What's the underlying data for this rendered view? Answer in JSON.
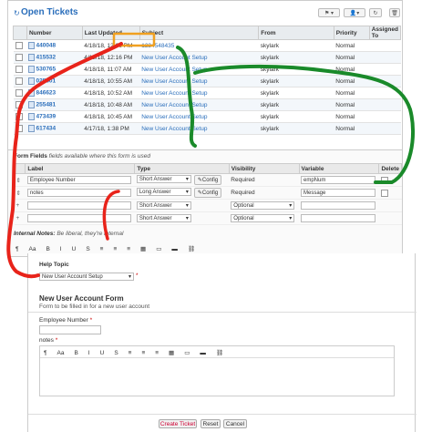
{
  "tickets": {
    "title": "Open Tickets",
    "columns": [
      "Number",
      "Last Updated",
      "Subject",
      "From",
      "Priority",
      "Assigned To"
    ],
    "rows": [
      {
        "number": "440048",
        "updated": "4/18/18, 12:26 PM",
        "subject": "1234548435",
        "from": "skylark",
        "priority": "Normal"
      },
      {
        "number": "415532",
        "updated": "4/18/18, 12:16 PM",
        "subject": "New User Account Setup",
        "from": "skylark",
        "priority": "Normal"
      },
      {
        "number": "530765",
        "updated": "4/18/18, 11:07 AM",
        "subject": "New User Account Setup",
        "from": "skylark",
        "priority": "Normal"
      },
      {
        "number": "025601",
        "updated": "4/18/18, 10:55 AM",
        "subject": "New User Account Setup",
        "from": "skylark",
        "priority": "Normal"
      },
      {
        "number": "846623",
        "updated": "4/18/18, 10:52 AM",
        "subject": "New User Account Setup",
        "from": "skylark",
        "priority": "Normal"
      },
      {
        "number": "255481",
        "updated": "4/18/18, 10:48 AM",
        "subject": "New User Account Setup",
        "from": "skylark",
        "priority": "Normal"
      },
      {
        "number": "473439",
        "updated": "4/18/18, 10:45 AM",
        "subject": "New User Account Setup",
        "from": "skylark",
        "priority": "Normal"
      },
      {
        "number": "617434",
        "updated": "4/17/18, 1:38 PM",
        "subject": "New User Account Setup",
        "from": "skylark",
        "priority": "Normal"
      }
    ]
  },
  "form_fields": {
    "heading": "Form Fields",
    "subheading": "fields available where this form is used",
    "columns": [
      "Label",
      "Type",
      "Visibility",
      "Variable",
      "Delete"
    ],
    "rows": [
      {
        "label": "Employee Number",
        "type": "Short Answer",
        "config": "Config",
        "visibility": "Required",
        "variable": "empNum"
      },
      {
        "label": "notes",
        "type": "Long Answer",
        "config": "Config",
        "visibility": "Required",
        "variable": "Message"
      },
      {
        "label": "",
        "type": "Short Answer",
        "config": "",
        "visibility": "Optional",
        "variable": ""
      },
      {
        "label": "",
        "type": "Short Answer",
        "config": "",
        "visibility": "Optional",
        "variable": ""
      }
    ],
    "internal_notes_label": "Internal Notes:",
    "internal_notes_text": "Be liberal, they're internal"
  },
  "toolbar": [
    "¶",
    "Aa",
    "B",
    "I",
    "U",
    "S",
    "≡",
    "≡",
    "≡",
    "▦",
    "▭",
    "▬",
    "⛓"
  ],
  "ticket_form": {
    "help_topic_label": "Help Topic",
    "help_topic_value": "New User Account Setup",
    "form_title": "New User Account Form",
    "form_desc": "Form to be filled in for a new user account",
    "employee_label": "Employee Number",
    "notes_label": "notes",
    "create_label": "Create Ticket",
    "reset_label": "Reset",
    "cancel_label": "Cancel"
  },
  "colors": {
    "accent": "#2a6ebb",
    "annotation_red": "#e8231a",
    "annotation_green": "#1a8a2a",
    "annotation_orange": "#f0a020"
  }
}
